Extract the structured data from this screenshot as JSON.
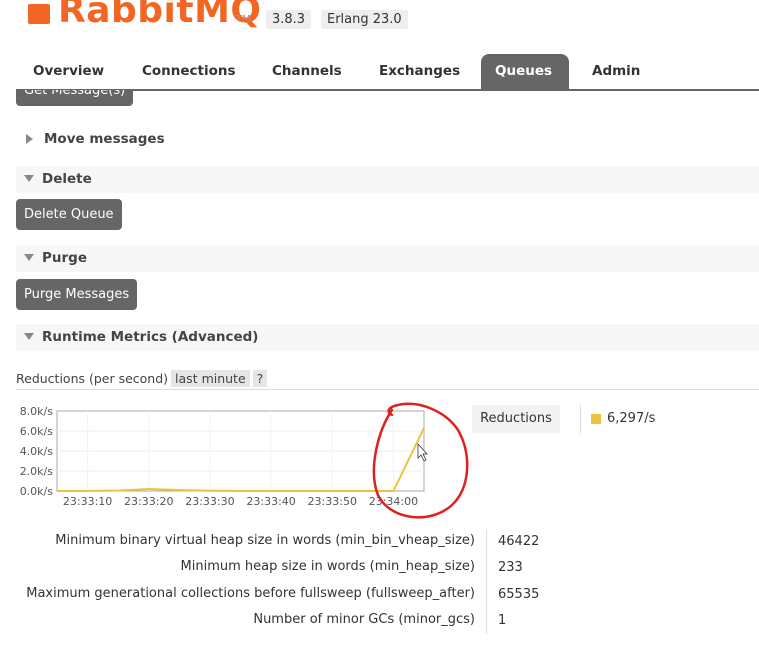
{
  "brand": {
    "name": "RabbitMQ",
    "tm": "TM",
    "version": "3.8.3",
    "erlang": "Erlang 23.0",
    "accent": "#f26522"
  },
  "nav": {
    "tabs": [
      {
        "label": "Overview"
      },
      {
        "label": "Connections"
      },
      {
        "label": "Channels"
      },
      {
        "label": "Exchanges"
      },
      {
        "label": "Queues",
        "active": true
      },
      {
        "label": "Admin"
      }
    ]
  },
  "actions": {
    "get_messages": "Get Message(s)",
    "delete_queue": "Delete Queue",
    "purge_messages": "Purge Messages"
  },
  "sections": {
    "move_messages": "Move messages",
    "delete": "Delete",
    "purge": "Purge",
    "runtime_metrics": "Runtime Metrics (Advanced)"
  },
  "reductions": {
    "label": "Reductions (per second)",
    "range": "last minute",
    "help": "?",
    "legend_name": "Reductions",
    "legend_value": "6,297/s",
    "series_color": "#edc240"
  },
  "chart_data": {
    "type": "line",
    "yticks": [
      "8.0k/s",
      "6.0k/s",
      "4.0k/s",
      "2.0k/s",
      "0.0k/s"
    ],
    "xticks": [
      "23:33:10",
      "23:33:20",
      "23:33:30",
      "23:33:40",
      "23:33:50",
      "23:34:00"
    ],
    "ylim": [
      0,
      8000
    ],
    "series": [
      {
        "name": "Reductions",
        "points": [
          [
            "23:33:05",
            0
          ],
          [
            "23:33:10",
            0
          ],
          [
            "23:33:15",
            50
          ],
          [
            "23:33:20",
            200
          ],
          [
            "23:33:25",
            100
          ],
          [
            "23:33:30",
            20
          ],
          [
            "23:33:35",
            0
          ],
          [
            "23:33:40",
            0
          ],
          [
            "23:33:45",
            0
          ],
          [
            "23:33:50",
            0
          ],
          [
            "23:33:55",
            0
          ],
          [
            "23:34:00",
            0
          ],
          [
            "23:34:05",
            6297
          ]
        ]
      }
    ]
  },
  "metrics": [
    {
      "label": "Minimum binary virtual heap size in words (min_bin_vheap_size)",
      "value": "46422"
    },
    {
      "label": "Minimum heap size in words (min_heap_size)",
      "value": "233"
    },
    {
      "label": "Maximum generational collections before fullsweep (fullsweep_after)",
      "value": "65535"
    },
    {
      "label": "Number of minor GCs (minor_gcs)",
      "value": "1"
    }
  ]
}
